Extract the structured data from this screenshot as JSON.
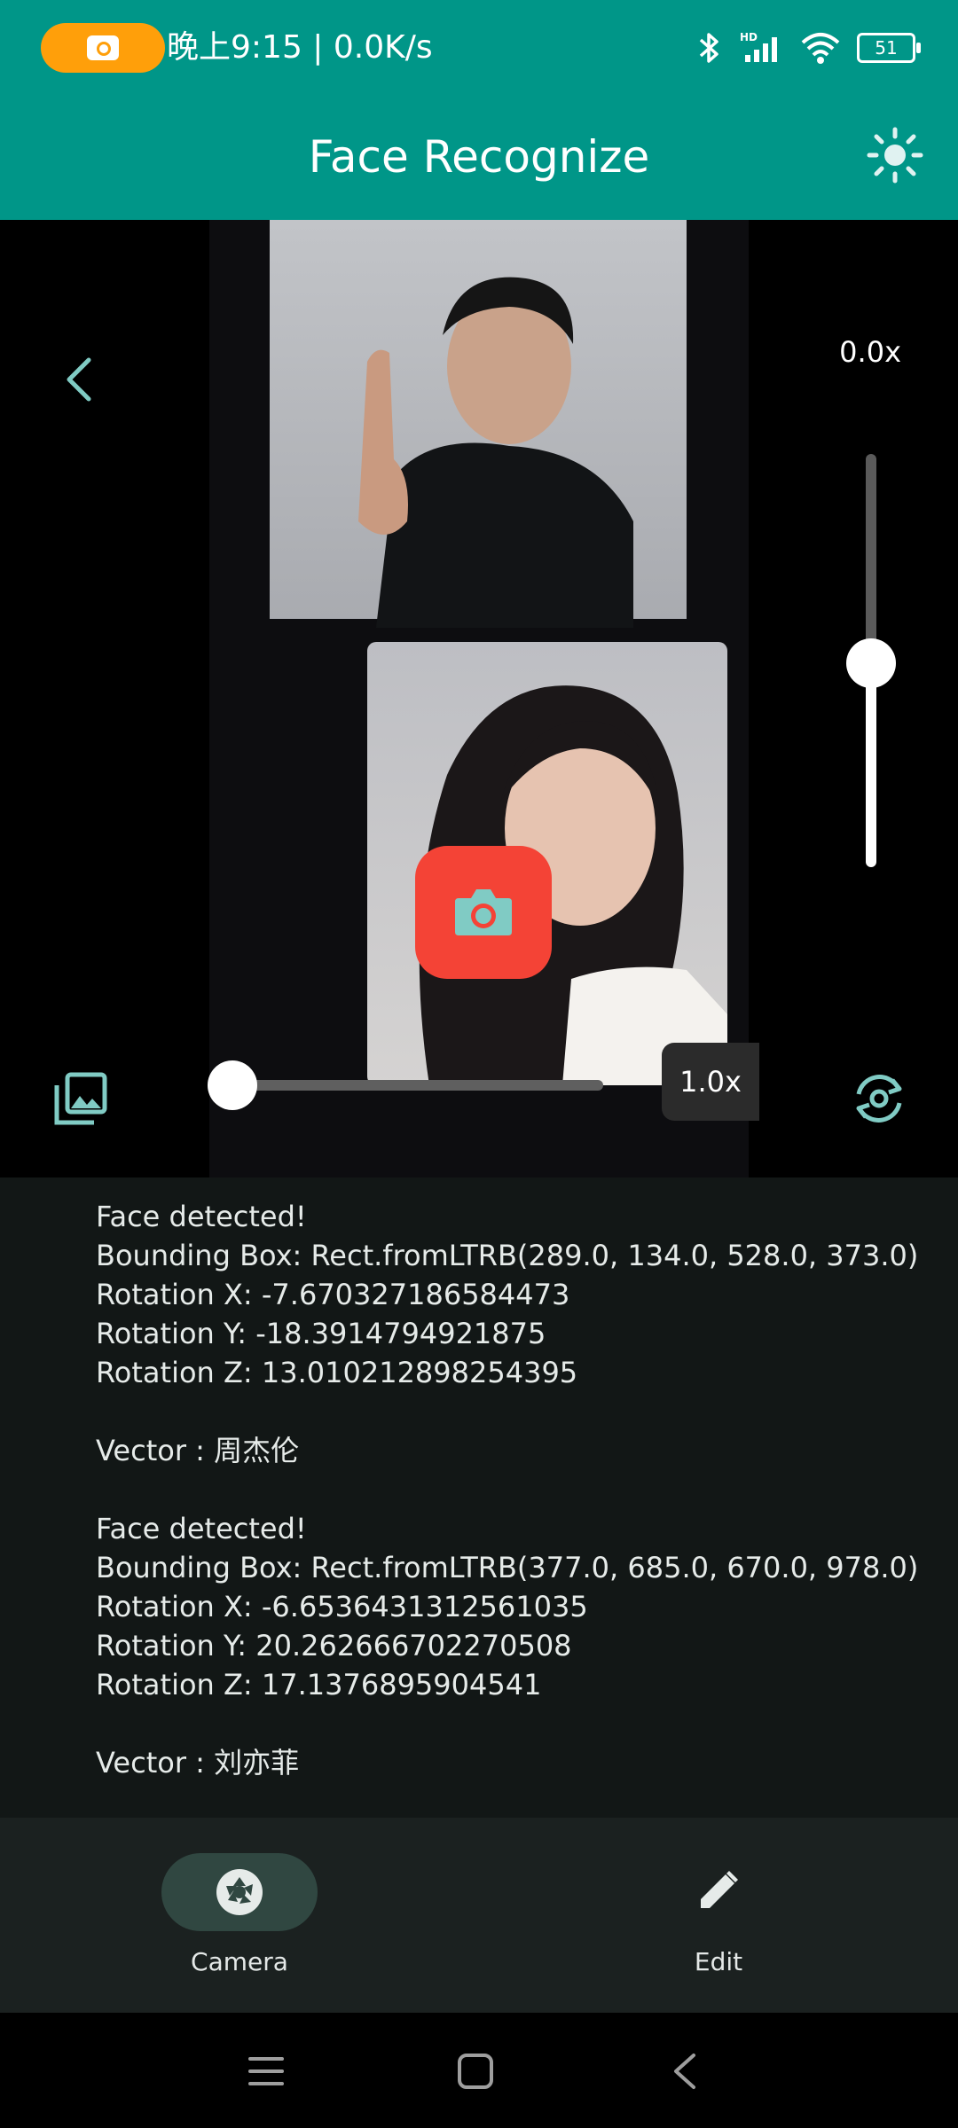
{
  "status_bar": {
    "time": "晚上9:15 | 0.0K/s",
    "battery": "51"
  },
  "app_bar": {
    "title": "Face Recognize"
  },
  "camera": {
    "zoom_label_vertical": "0.0x",
    "zoom_label_horizontal": "1.0x",
    "vertical_slider_value": 0.49,
    "horizontal_slider_value": 0.0
  },
  "results": [
    "Face detected!",
    "Bounding Box: Rect.fromLTRB(289.0, 134.0, 528.0, 373.0)",
    "Rotation X: -7.670327186584473",
    "Rotation Y: -18.3914794921875",
    "Rotation Z: 13.010212898254395",
    "",
    "Vector : 周杰伦",
    "",
    "Face detected!",
    "Bounding Box: Rect.fromLTRB(377.0, 685.0, 670.0, 978.0)",
    "Rotation X: -6.6536431312561035",
    "Rotation Y: 20.262666702270508",
    "Rotation Z: 17.1376895904541",
    "",
    "Vector : 刘亦菲"
  ],
  "bottom_nav": {
    "camera_label": "Camera",
    "edit_label": "Edit"
  },
  "colors": {
    "app_bar": "#009688",
    "shutter": "#f44336",
    "accent_icon": "#80cbc4",
    "recording_pill": "#ff9f0a"
  },
  "icons": [
    "camera-icon",
    "bluetooth-icon",
    "signal-icon",
    "wifi-icon",
    "battery-icon",
    "brightness-icon",
    "back-arrow-icon",
    "gallery-icon",
    "flip-camera-icon",
    "shutter-icon",
    "edit-icon",
    "menu-icon",
    "home-icon",
    "back-icon"
  ]
}
